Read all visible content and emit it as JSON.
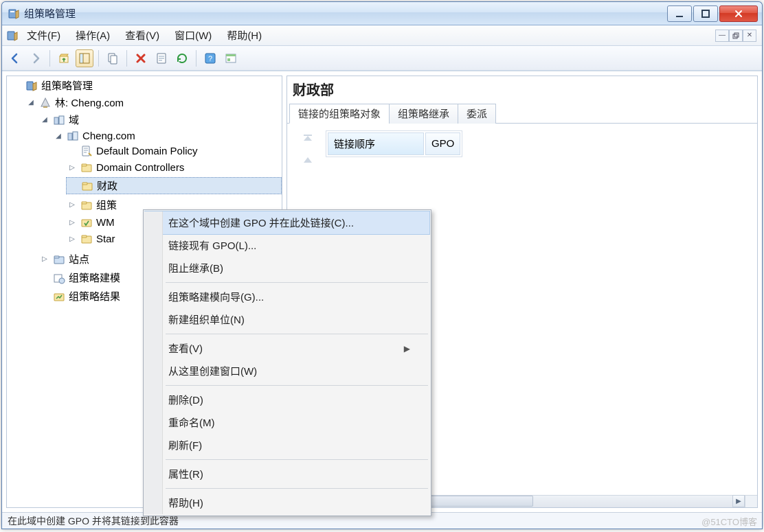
{
  "window": {
    "title": "组策略管理"
  },
  "menubar": {
    "file": "文件(F)",
    "action": "操作(A)",
    "view": "查看(V)",
    "window": "窗口(W)",
    "help": "帮助(H)"
  },
  "tree": {
    "root": "组策略管理",
    "forest": "林: Cheng.com",
    "domains": "域",
    "domain_name": "Cheng.com",
    "default_policy": "Default Domain Policy",
    "domain_controllers": "Domain Controllers",
    "ou_finance": "财政",
    "ou_group_policy": "组策",
    "wmi": "WM",
    "starter": "Star",
    "sites": "站点",
    "modeling": "组策略建模",
    "results": "组策略结果"
  },
  "details": {
    "title": "财政部",
    "tabs": {
      "linked": "链接的组策略对象",
      "inheritance": "组策略继承",
      "delegation": "委派"
    },
    "grid": {
      "link_order": "链接顺序",
      "gpo": "GPO"
    }
  },
  "context_menu": {
    "create_gpo_link": "在这个域中创建 GPO 并在此处链接(C)...",
    "link_existing": "链接现有 GPO(L)...",
    "block_inheritance": "阻止继承(B)",
    "modeling_wizard": "组策略建模向导(G)...",
    "new_ou": "新建组织单位(N)",
    "view": "查看(V)",
    "new_window": "从这里创建窗口(W)",
    "delete": "删除(D)",
    "rename": "重命名(M)",
    "refresh": "刷新(F)",
    "properties": "属性(R)",
    "help": "帮助(H)"
  },
  "statusbar": {
    "text": "在此域中创建 GPO 并将其链接到此容器"
  },
  "watermark": "@51CTO博客"
}
